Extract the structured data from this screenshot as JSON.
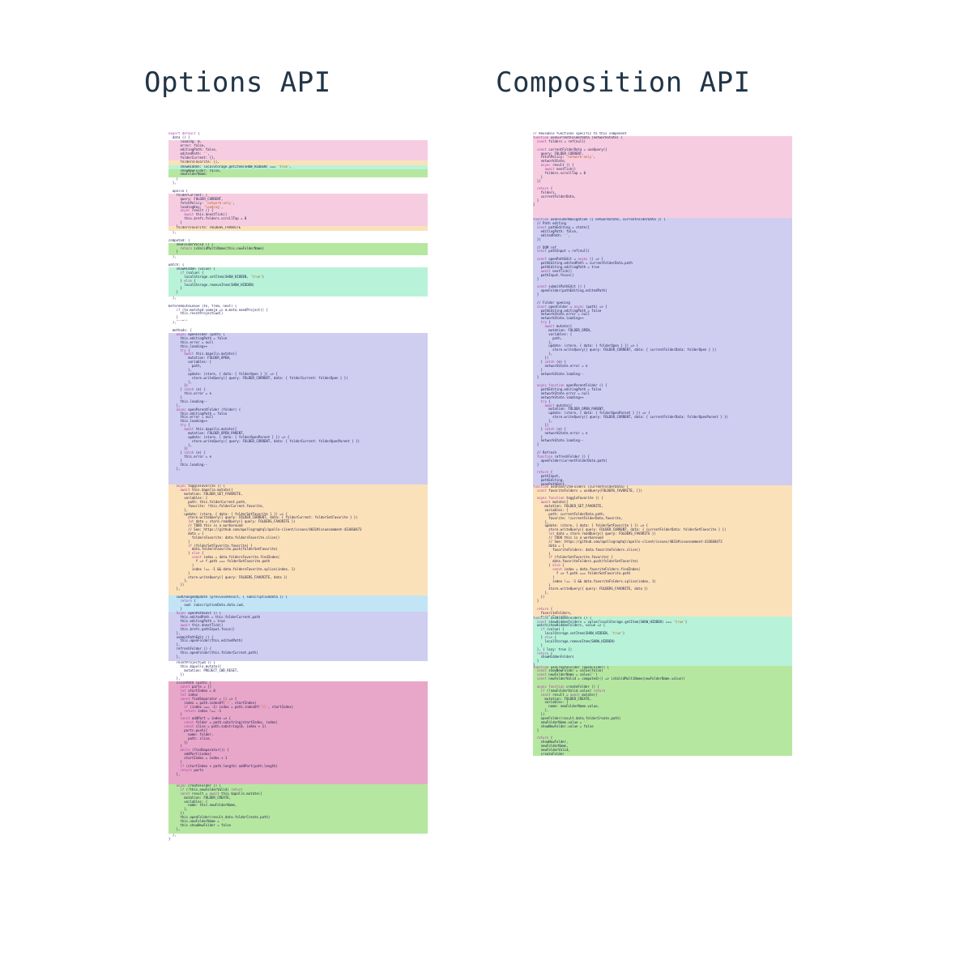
{
  "headings": {
    "left": "Options API",
    "right": "Composition API"
  },
  "colors": {
    "neutral": "transparent",
    "pink": "#f6cde0",
    "mint": "#b8f2d8",
    "violet": "#cfcef0",
    "green": "#b6e7a0",
    "orange": "#fbe1ba",
    "blue": "#c2e5f6",
    "magenta": "#e8a7c9"
  },
  "left": [
    {
      "color": "neutral",
      "lines": 2,
      "font": 4,
      "text": "export default {\n  data () {\n    return {"
    },
    {
      "color": "pink",
      "lines": 5,
      "font": 4,
      "text": "      loading: 0,\n      error: false,\n      editingPath: false,\n      editedPath: '',\n      folderCurrent: {},"
    },
    {
      "color": "orange",
      "lines": 1,
      "font": 4,
      "text": "      foldersFavorite: [],"
    },
    {
      "color": "mint",
      "lines": 1,
      "font": 4,
      "text": "      showHidden: localStorage.getItem(SHOW_HIDDEN) === 'true',"
    },
    {
      "color": "green",
      "lines": 2,
      "font": 4,
      "text": "      showNewFolder: false,\n      newFolderName: ''"
    },
    {
      "color": "neutral",
      "lines": 3,
      "font": 4,
      "text": "    }\n  },\n  "
    },
    {
      "color": "neutral",
      "lines": 1,
      "font": 4,
      "text": "  apollo {"
    },
    {
      "color": "pink",
      "lines": 8,
      "font": 4,
      "text": "    folderCurrent: {\n      query: FOLDER_CURRENT,\n      fetchPolicy: 'network-only',\n      loadingKey: 'loading',\n      async result () {\n        await this.$nextTick()\n        this.$refs.folders.scrollTop = 0\n      }\n    },"
    },
    {
      "color": "orange",
      "lines": 1,
      "font": 4,
      "text": "    foldersFavorite: FOLDERS_FAVORITE"
    },
    {
      "color": "neutral",
      "lines": 2,
      "font": 4,
      "text": "  },\n  "
    },
    {
      "color": "neutral",
      "lines": 1,
      "font": 4,
      "text": "computed: {"
    },
    {
      "color": "green",
      "lines": 3,
      "font": 4,
      "text": "    newFolderValid () {\n      return isValidMultiName(this.newFolderName)\n    }"
    },
    {
      "color": "neutral",
      "lines": 2,
      "font": 4,
      "text": "  },\n  "
    },
    {
      "color": "neutral",
      "lines": 1,
      "font": 4,
      "text": "watch: {"
    },
    {
      "color": "mint",
      "lines": 7,
      "font": 4,
      "text": "    showHidden (value) {\n      if (value) {\n        localStorage.setItem(SHOW_HIDDEN, 'true')\n      } else {\n        localStorage.removeItem(SHOW_HIDDEN)\n      }\n    }"
    },
    {
      "color": "neutral",
      "lines": 2,
      "font": 4,
      "text": "  },\n  "
    },
    {
      "color": "neutral",
      "lines": 4,
      "font": 4,
      "text": "beforeRouteLeave (to, from, next) {\n    if (to.matched.some(m => m.meta.needProject)) {\n      this.resetProjectCwd()\n    }\n    next()"
    },
    {
      "color": "neutral",
      "lines": 3,
      "font": 4,
      "text": "  },\n  \n  methods: {"
    },
    {
      "color": "violet",
      "lines": 37,
      "font": 4,
      "text": "    async openFolder (path) {\n      this.editingPath = false\n      this.error = null\n      this.loading++\n      try {\n        await this.$apollo.mutate({\n          mutation: FOLDER_OPEN,\n          variables: {\n            path,\n          },\n          update: (store, { data: { folderOpen } }) => {\n            store.writeQuery({ query: FOLDER_CURRENT, data: { folderCurrent: folderOpen } })\n          },\n        })\n      } catch (e) {\n        this.error = e\n      }\n      this.loading--\n    },\n    async openParentFolder (folder) {\n      this.editingPath = false\n      this.error = null\n      this.loading++\n      try {\n        await this.$apollo.mutate({\n          mutation: FOLDER_OPEN_PARENT,\n          update: (store, { data: { folderOpenParent } }) => {\n            store.writeQuery({ query: FOLDER_CURRENT, data: { folderCurrent: folderOpenParent } })\n          },\n        })\n      } catch (e) {\n        this.error = e\n      }\n      this.loading--\n    },"
    },
    {
      "color": "orange",
      "lines": 27,
      "font": 4,
      "text": "    async toggleFavorite () {\n      await this.$apollo.mutate({\n        mutation: FOLDER_SET_FAVORITE,\n        variables: {\n          path: this.folderCurrent.path,\n          favorite: !this.folderCurrent.favorite,\n        },\n        update: (store, { data: { folderSetFavorite } }) => {\n          store.writeQuery({ query: FOLDER_CURRENT, data: { folderCurrent: folderSetFavorite } })\n          let data = store.readQuery({ query: FOLDERS_FAVORITE })\n          // TODO this is a workaround\n          // See: https://github.com/apollographql/apollo-client/issues/4031#issuecomment-433668473\n          data = {\n            foldersFavorite: data.foldersFavorite.slice()\n          }\n          if (folderSetFavorite.favorite) {\n            data.foldersFavorite.push(folderSetFavorite)\n          } else {\n            const index = data.foldersFavorite.findIndex(\n              f => f.path === folderSetFavorite.path\n            )\n            index !== -1 && data.foldersFavorite.splice(index, 1)\n          }\n          store.writeQuery({ query: FOLDERS_FAVORITE, data })\n        },\n      })\n    },"
    },
    {
      "color": "blue",
      "lines": 4,
      "font": 4,
      "text": "    cwdChangedUpdate (previousResult, { subscriptionData }) {\n      return {\n        cwd: subscriptionData.data.cwd,\n      }\n    },"
    },
    {
      "color": "violet",
      "lines": 12,
      "font": 4,
      "text": "    async openPathEdit () {\n      this.editedPath = this.folderCurrent.path\n      this.editingPath = true\n      await this.$nextTick()\n      this.$refs.pathInput.focus()\n    },\n    submitPathEdit () {\n      this.openFolder(this.editedPath)\n    },\n    refreshFolder () {\n      this.openFolder(this.folderCurrent.path)\n    },"
    },
    {
      "color": "neutral",
      "lines": 5,
      "font": 4,
      "text": "    resetProjectCwd () {\n      this.$apollo.mutate({\n        mutation: PROJECT_CWD_RESET,\n      })\n    },"
    },
    {
      "color": "magenta",
      "lines": 25,
      "font": 4,
      "text": "    slicePath (path) {\n      const parts = []\n      let startIndex = 0\n      let index\n      const findSeparator = () => {\n        index = path.indexOf('/', startIndex)\n        if (index === -1) index = path.indexOf('\\\\', startIndex)\n        return index !== -1\n      }\n      const addPart = index => {\n        const folder = path.substring(startIndex, index)\n        const slice = path.substring(0, index + 1)\n        parts.push({\n          name: folder,\n          path: slice,\n        })\n      }\n      while (findSeparator()) {\n        addPart(index)\n        startIndex = index + 1\n      }\n      if (startIndex < path.length) addPart(path.length)\n      return parts\n    },"
    },
    {
      "color": "green",
      "lines": 12,
      "font": 4,
      "text": "    async createFolder () {\n      if (!this.newFolderValid) return\n      const result = await this.$apollo.mutate({\n        mutation: FOLDER_CREATE,\n        variables: {\n          name: this.newFolderName,\n        },\n      })\n      this.openFolder(result.data.folderCreate.path)\n      this.newFolderName = ''\n      this.showNewFolder = false\n    },"
    },
    {
      "color": "neutral",
      "lines": 2,
      "font": 4,
      "text": "  },\n}"
    }
  ],
  "right": [
    {
      "color": "neutral",
      "lines": 1,
      "font": 4,
      "text": "// Reusable functions specific to this component"
    },
    {
      "color": "pink",
      "lines": 20,
      "font": 4,
      "text": "function useCurrentFolderData (networkState) {\n  const folders = ref(null)\n\n  const currentFolderData = useQuery({\n    query: FOLDER_CURRENT,\n    fetchPolicy: 'network-only',\n    networkState,\n    async result () {\n      await nextTick()\n      folders.scrollTop = 0\n    }\n  })\n\n  return {\n    folders,\n    currentFolderData,\n  }\n}"
    },
    {
      "color": "violet",
      "lines": 65,
      "font": 4,
      "text": "function useFolderNavigation ({ networkState, currentFolderData }) {\n  // Path editing\n  const pathEditing = state({\n    editingPath: false,\n    editedPath: '',\n  })\n\n  // DOM ref\n  const pathInput = ref(null)\n\n  const openPathEdit = async () => {\n    pathEditing.editedPath = currentFolderData.path\n    pathEditing.editingPath = true\n    await nextTick()\n    pathInput.focus()\n  }\n\n  const submitPathEdit () {\n    openFolder(pathEditing.editedPath)\n  }\n\n  // Folder opening\n  const openFolder = async (path) => {\n    pathEditing.editingPath = false\n    networkState.error = null\n    networkState.loading++\n    try {\n      await mutate({\n        mutation: FOLDER_OPEN,\n        variables: {\n          path,\n        },\n        update: (store, { data: { folderOpen } }) => {\n          store.writeQuery({ query: FOLDER_CURRENT, data: { currentFolderData: folderOpen } })\n        },\n      })\n    } catch (e) {\n      networkState.error = e\n    }\n    networkState.loading--\n  }\n\n  async function openParentFolder () {\n    pathEditing.editingPath = false\n    networkState.error = null\n    networkState.loading++\n    try {\n      await mutate({\n        mutation: FOLDER_OPEN_PARENT,\n        update: (store, { data: { folderOpenParent } }) => {\n          store.writeQuery({ query: FOLDER_CURRENT, data: { currentFolderData: folderOpenParent } })\n        },\n      })\n    } catch (e) {\n      networkState.error = e\n    }\n    networkState.loading--\n  }\n\n  // Refresh\n  function refreshFolder () {\n    openFolder(currentFolderData.path)\n  }\n\n  return {\n    pathInput,\n    pathEditing,\n    openPathEdit,\n    submitPathEdit,\n    openFolder,\n    openParentFolder,\n    refreshFolder,\n  }\n}"
    },
    {
      "color": "orange",
      "lines": 32,
      "font": 4,
      "text": "function useFavoriteFolders (currentFolderData) {\n  const favoriteFolders = useQuery(FOLDERS_FAVORITE, [])\n\n  async function toggleFavorite () {\n    await mutate({\n      mutation: FOLDER_SET_FAVORITE,\n      variables: {\n        path: currentFolderData.path,\n        favorite: !currentFolderData.favorite,\n      },\n      update: (store, { data: { folderSetFavorite } }) => {\n        store.writeQuery({ query: FOLDER_CURRENT, data: { currentFolderData: folderSetFavorite } })\n        let data = store.readQuery({ query: FOLDERS_FAVORITE })\n        // TODO this is a workaround\n        // See: https://github.com/apollographql/apollo-client/issues/4031#issuecomment-433668473\n        data = {\n          favoriteFolders: data.favoriteFolders.slice()\n        }\n        if (folderSetFavorite.favorite) {\n          data.favoriteFolders.push(folderSetFavorite)\n        } else {\n          const index = data.favoriteFolders.findIndex(\n            f => f.path === folderSetFavorite.path\n          )\n          index !== -1 && data.favoriteFolders.splice(index, 1)\n        }\n        store.writeQuery({ query: FOLDERS_FAVORITE, data })\n      },\n    })\n  }\n\n  return {\n    favoriteFolders,\n    toggleFavorite\n  }\n}"
    },
    {
      "color": "mint",
      "lines": 12,
      "font": 4,
      "text": "function useHiddenFolders () {\n  const showHiddenFolders = value(localStorage.getItem(SHOW_HIDDEN) === 'true')\n  watch(showHiddenFolders, value => {\n    if (value) {\n      localStorage.setItem(SHOW_HIDDEN, 'true')\n    } else {\n      localStorage.removeItem(SHOW_HIDDEN)\n    }\n  }, { lazy: true })\n  return {\n    showHiddenFolders\n  }\n}"
    },
    {
      "color": "green",
      "lines": 22,
      "font": 4,
      "text": "function useCreateFolder (openFolder) {\n  const showNewFolder = value(false)\n  const newFolderName = value('')\n  const newFolderValid = computed(() => isValidMultiName(newFolderName.value))\n\n  async function createFolder () {\n    if (!newFolderValid.value) return\n    const result = await mutate({\n      mutation: FOLDER_CREATE,\n      variables: {\n        name: newFolderName.value,\n      },\n    })\n    openFolder(result.data.folderCreate.path)\n    newFolderName.value = ''\n    showNewFolder.value = false\n  }\n\n  return {\n    showNewFolder,\n    newFolderName,\n    newFolderValid,\n    createFolder\n  }\n}"
    }
  ]
}
